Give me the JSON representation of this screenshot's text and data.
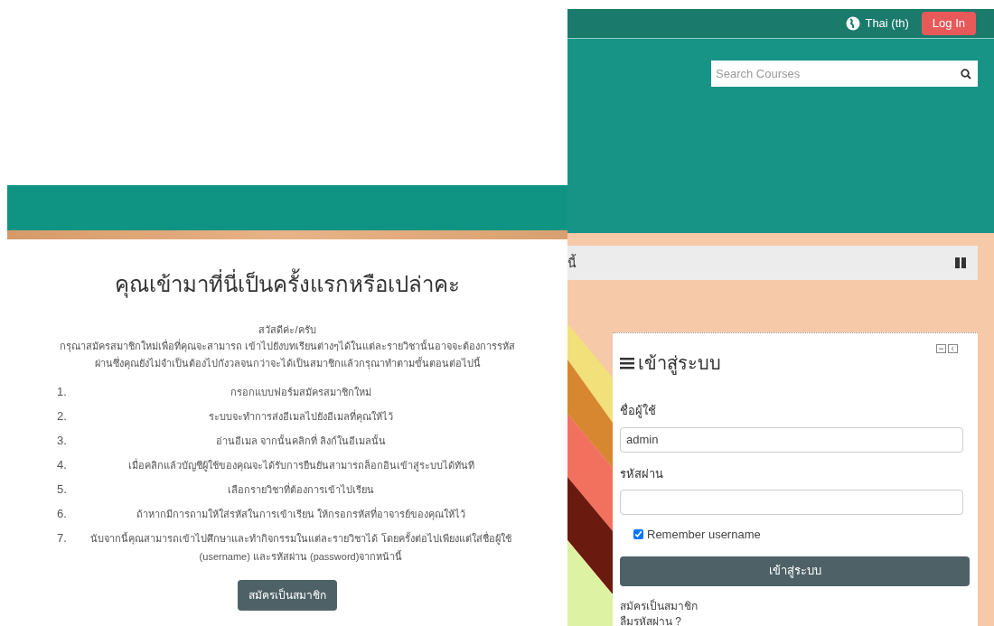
{
  "signup_panel": {
    "heading": "คุณเข้ามาที่นี่เป็นครั้งแรกหรือเปล่าคะ",
    "greeting": "สวัสดีค่ะ/ครับ",
    "intro": "กรุณาสมัครสมาชิกใหม่เพื่อที่คุณจะสามารถ เข้าไปยังบทเรียนต่างๆได้ในแต่ละรายวิชานั้นอาจจะต้องการรหัสผ่านซึ่งคุณยังไม่จำเป็นต้องไปกังวลจนกว่าจะได้เป็นสมาชิกแล้วกรุณาทำตามขั้นตอนต่อไปนี้",
    "steps": [
      {
        "number": "1.",
        "text": "กรอกแบบฟอร์มสมัครสมาชิกใหม่"
      },
      {
        "number": "2.",
        "text": "ระบบจะทำการส่งอีเมลไปยังอีเมลที่คุณให้ไว้"
      },
      {
        "number": "3.",
        "text": "อ่านอีเมล จากนั้นคลิกที่ ลิงก์ในอีเมลนั้น"
      },
      {
        "number": "4.",
        "text": "เมื่อคลิกแล้วบัญชีผู้ใช้ของคุณจะได้รับการยืนยันสามารถล็อกอินเข้าสู่ระบบได้ทันที"
      },
      {
        "number": "5.",
        "text": "เลือกรายวิชาที่ต้องการเข้าไปเรียน"
      },
      {
        "number": "6.",
        "text": "ถ้าหากมีการถามให้ใส่รหัสในการเข้าเรียน ให้กรอกรหัสที่อาจารย์ของคุณให้ไว้"
      },
      {
        "number": "7.",
        "text": "นับจากนี้คุณสามารถเข้าไปศึกษาและทำกิจกรรมในแต่ละรายวิชาได้ โดยครั้งต่อไปเพียงแต่ใส่ชื่อผู้ใช้ (username) และรหัสผ่าน (password)จากหน้านี้"
      }
    ],
    "button": "สมัครเป็นสมาชิก"
  },
  "navbar": {
    "language": "Thai (th)",
    "login_button": "Log In"
  },
  "search": {
    "placeholder": "Search Courses"
  },
  "notice_bar": {
    "text": "นี้"
  },
  "login_block": {
    "title": "เข้าสู่ระบบ",
    "username_label": "ชื่อผู้ใช้",
    "username_value": "admin",
    "password_label": "รหัสผ่าน",
    "remember": {
      "label": "Remember username",
      "checked": true
    },
    "submit": "เข้าสู่ระบบ",
    "links": [
      "สมัครเป็นสมาชิก",
      "ลืมรหัสผ่าน ?"
    ]
  }
}
